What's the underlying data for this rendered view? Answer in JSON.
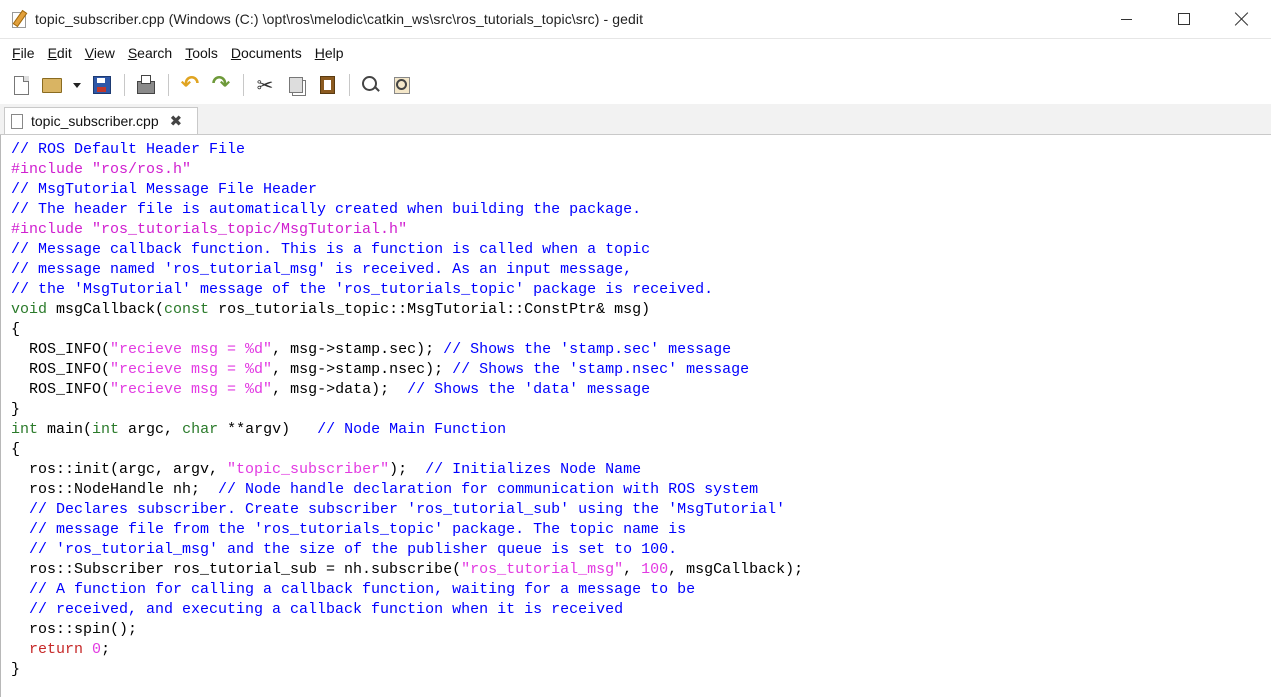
{
  "window": {
    "title": "topic_subscriber.cpp (Windows (C:) \\opt\\ros\\melodic\\catkin_ws\\src\\ros_tutorials_topic\\src) - gedit"
  },
  "menu": [
    {
      "pre": "",
      "u": "F",
      "post": "ile"
    },
    {
      "pre": "",
      "u": "E",
      "post": "dit"
    },
    {
      "pre": "",
      "u": "V",
      "post": "iew"
    },
    {
      "pre": "",
      "u": "S",
      "post": "earch"
    },
    {
      "pre": "",
      "u": "T",
      "post": "ools"
    },
    {
      "pre": "",
      "u": "D",
      "post": "ocuments"
    },
    {
      "pre": "",
      "u": "H",
      "post": "elp"
    }
  ],
  "toolbar": {
    "icons": [
      "new-document-icon",
      "open-icon",
      "open-recent-arrow-icon",
      "save-icon",
      "print-icon",
      "undo-icon",
      "redo-icon",
      "cut-icon",
      "copy-icon",
      "paste-icon",
      "find-icon",
      "find-replace-icon"
    ]
  },
  "tab": {
    "label": "topic_subscriber.cpp"
  },
  "colors": {
    "comment": "#0000ff",
    "preprocessor": "#d020d0",
    "string": "#e23ae2",
    "keyword": "#2a7a2a",
    "return": "#c62828"
  },
  "code_lines": [
    [
      [
        "c",
        "// ROS Default Header File"
      ]
    ],
    [
      [
        "p",
        "#include \"ros/ros.h\""
      ]
    ],
    [
      [
        "c",
        "// MsgTutorial Message File Header"
      ]
    ],
    [
      [
        "c",
        "// The header file is automatically created when building the package."
      ]
    ],
    [
      [
        "p",
        "#include \"ros_tutorials_topic/MsgTutorial.h\""
      ]
    ],
    [
      [
        "c",
        "// Message callback function. This is a function is called when a topic"
      ]
    ],
    [
      [
        "c",
        "// message named 'ros_tutorial_msg' is received. As an input message,"
      ]
    ],
    [
      [
        "c",
        "// the 'MsgTutorial' message of the 'ros_tutorials_topic' package is received."
      ]
    ],
    [
      [
        "k",
        "void"
      ],
      [
        "t",
        " msgCallback("
      ],
      [
        "k",
        "const"
      ],
      [
        "t",
        " ros_tutorials_topic::MsgTutorial::ConstPtr& msg)"
      ]
    ],
    [
      [
        "t",
        "{"
      ]
    ],
    [
      [
        "t",
        "  ROS_INFO("
      ],
      [
        "s",
        "\"recieve msg = %d\""
      ],
      [
        "t",
        ", msg->stamp.sec); "
      ],
      [
        "c",
        "// Shows the 'stamp.sec' message"
      ]
    ],
    [
      [
        "t",
        "  ROS_INFO("
      ],
      [
        "s",
        "\"recieve msg = %d\""
      ],
      [
        "t",
        ", msg->stamp.nsec); "
      ],
      [
        "c",
        "// Shows the 'stamp.nsec' message"
      ]
    ],
    [
      [
        "t",
        "  ROS_INFO("
      ],
      [
        "s",
        "\"recieve msg = %d\""
      ],
      [
        "t",
        ", msg->data);  "
      ],
      [
        "c",
        "// Shows the 'data' message"
      ]
    ],
    [
      [
        "t",
        "}"
      ]
    ],
    [
      [
        "k",
        "int"
      ],
      [
        "t",
        " main("
      ],
      [
        "k",
        "int"
      ],
      [
        "t",
        " argc, "
      ],
      [
        "k",
        "char"
      ],
      [
        "t",
        " **argv)   "
      ],
      [
        "c",
        "// Node Main Function"
      ]
    ],
    [
      [
        "t",
        "{"
      ]
    ],
    [
      [
        "t",
        "  ros::init(argc, argv, "
      ],
      [
        "s",
        "\"topic_subscriber\""
      ],
      [
        "t",
        ");  "
      ],
      [
        "c",
        "// Initializes Node Name"
      ]
    ],
    [
      [
        "t",
        "  ros::NodeHandle nh;  "
      ],
      [
        "c",
        "// Node handle declaration for communication with ROS system"
      ]
    ],
    [
      [
        "c",
        "  // Declares subscriber. Create subscriber 'ros_tutorial_sub' using the 'MsgTutorial'"
      ]
    ],
    [
      [
        "c",
        "  // message file from the 'ros_tutorials_topic' package. The topic name is"
      ]
    ],
    [
      [
        "c",
        "  // 'ros_tutorial_msg' and the size of the publisher queue is set to 100."
      ]
    ],
    [
      [
        "t",
        "  ros::Subscriber ros_tutorial_sub = nh.subscribe("
      ],
      [
        "s",
        "\"ros_tutorial_msg\""
      ],
      [
        "t",
        ", "
      ],
      [
        "n",
        "100"
      ],
      [
        "t",
        ", msgCallback);"
      ]
    ],
    [
      [
        "c",
        "  // A function for calling a callback function, waiting for a message to be"
      ]
    ],
    [
      [
        "c",
        "  // received, and executing a callback function when it is received"
      ]
    ],
    [
      [
        "t",
        "  ros::spin();"
      ]
    ],
    [
      [
        "t",
        "  "
      ],
      [
        "r",
        "return"
      ],
      [
        "t",
        " "
      ],
      [
        "n",
        "0"
      ],
      [
        "t",
        ";"
      ]
    ],
    [
      [
        "t",
        "}"
      ]
    ]
  ]
}
